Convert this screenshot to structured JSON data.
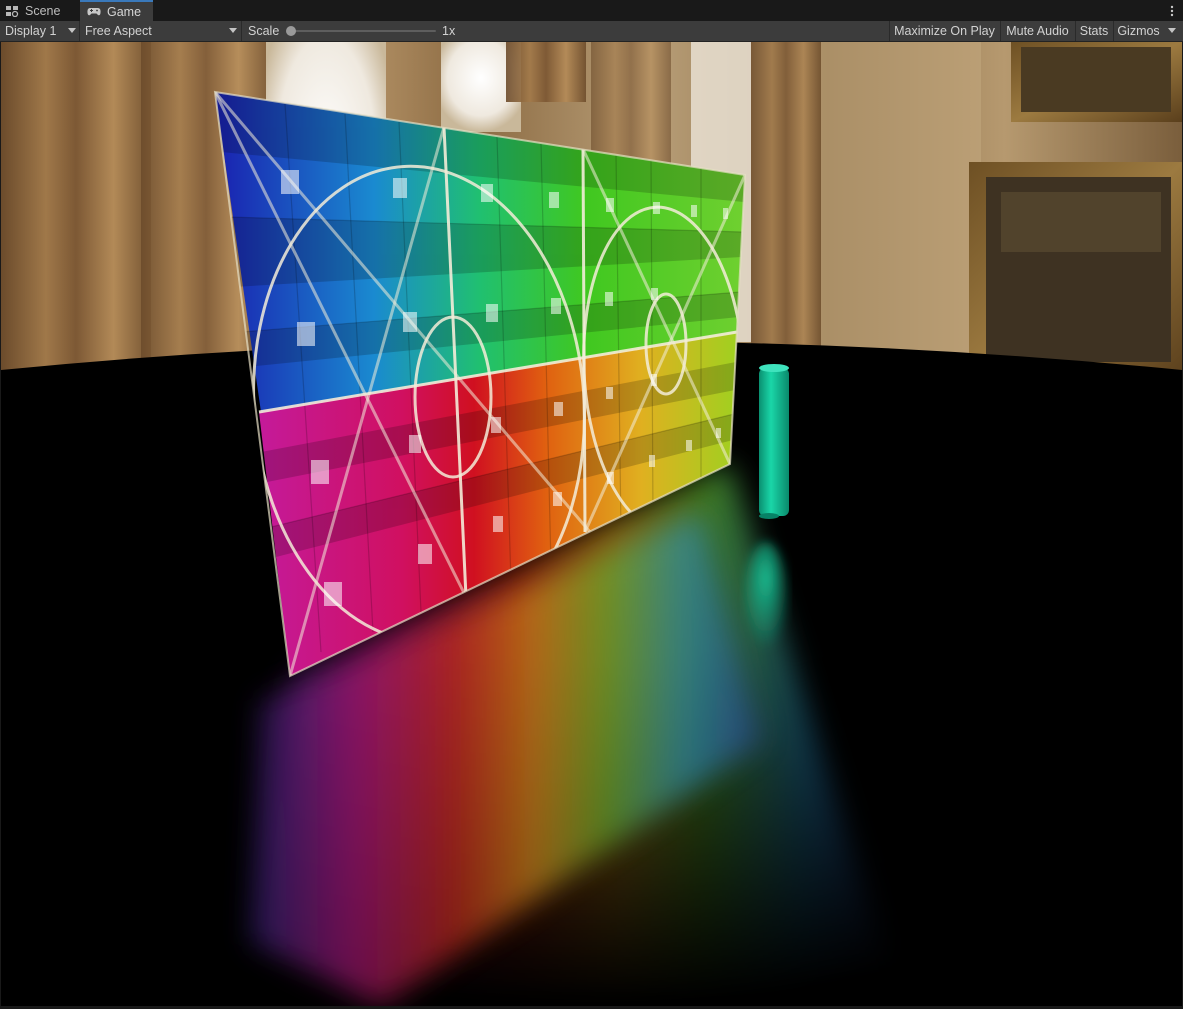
{
  "tabs": [
    {
      "label": "Scene",
      "icon": "grid-icon",
      "active": false
    },
    {
      "label": "Game",
      "icon": "gamepad-icon",
      "active": true
    }
  ],
  "toolbar": {
    "display": "Display 1",
    "aspect": "Free Aspect",
    "scale_label": "Scale",
    "scale_value": "1x",
    "maximize_on_play": "Maximize On Play",
    "mute_audio": "Mute Audio",
    "stats": "Stats",
    "gizmos": "Gizmos"
  },
  "colors": {
    "accent": "#3a79bb",
    "toolbar_bg": "#3c3c3c",
    "window_bg": "#191919",
    "cylinder": "#12c29a"
  }
}
